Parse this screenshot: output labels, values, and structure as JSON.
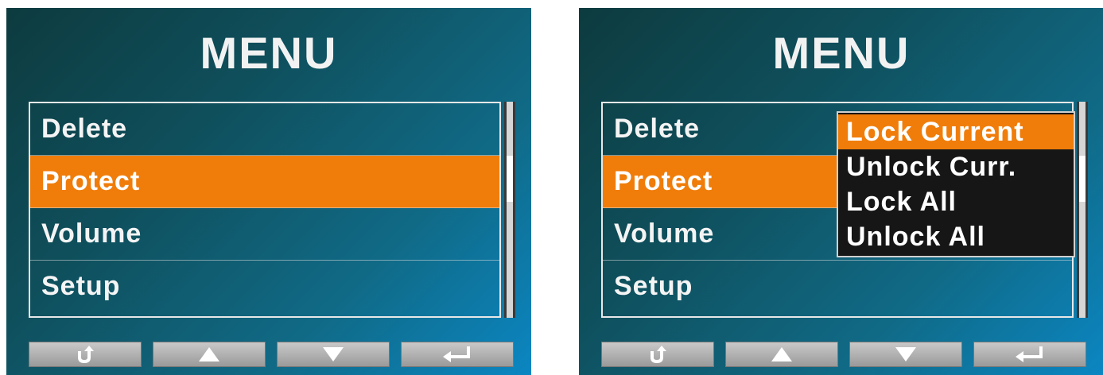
{
  "screens": [
    {
      "title": "MENU",
      "menu_items": [
        "Delete",
        "Protect",
        "Volume",
        "Setup"
      ],
      "selected_index": 1
    },
    {
      "title": "MENU",
      "menu_items": [
        "Delete",
        "Protect",
        "Volume",
        "Setup"
      ],
      "selected_index": 1,
      "popup": {
        "items": [
          "Lock Current",
          "Unlock Curr.",
          "Lock All",
          "Unlock All"
        ],
        "selected_index": 0
      }
    }
  ],
  "buttons": [
    {
      "icon": "back-icon",
      "label": "back"
    },
    {
      "icon": "up-arrow-icon",
      "label": "up"
    },
    {
      "icon": "down-arrow-icon",
      "label": "down"
    },
    {
      "icon": "enter-icon",
      "label": "enter"
    }
  ],
  "colors": {
    "selected": "#f07d0a",
    "background_gradient_start": "#0d3b3f",
    "background_gradient_end": "#0b86c2",
    "popup_background": "#161616"
  }
}
